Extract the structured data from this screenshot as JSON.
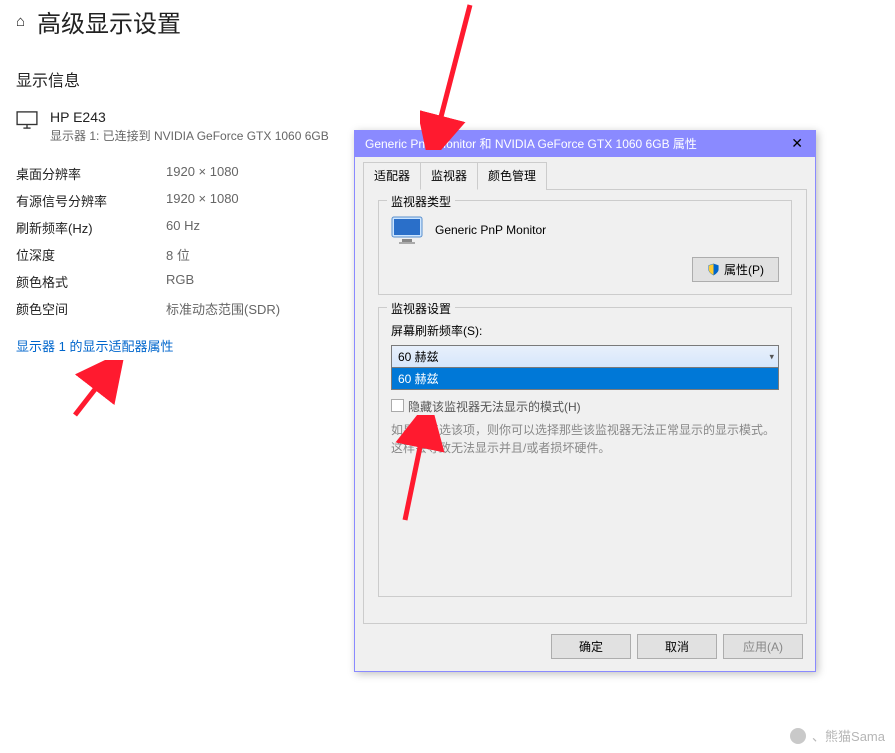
{
  "header": {
    "title": "高级显示设置"
  },
  "section_title": "显示信息",
  "monitor": {
    "name": "HP E243",
    "desc": "显示器 1: 已连接到 NVIDIA GeForce GTX 1060 6GB"
  },
  "props": [
    {
      "label": "桌面分辨率",
      "value": "1920 × 1080"
    },
    {
      "label": "有源信号分辨率",
      "value": "1920 × 1080"
    },
    {
      "label": "刷新频率(Hz)",
      "value": "60 Hz"
    },
    {
      "label": "位深度",
      "value": "8 位"
    },
    {
      "label": "颜色格式",
      "value": "RGB"
    },
    {
      "label": "颜色空间",
      "value": "标准动态范围(SDR)"
    }
  ],
  "link": "显示器 1 的显示适配器属性",
  "dialog": {
    "title": "Generic PnP Monitor 和 NVIDIA GeForce GTX 1060 6GB 属性",
    "tabs": {
      "adapter": "适配器",
      "monitor": "监视器",
      "color": "颜色管理"
    },
    "group1_title": "监视器类型",
    "monitor_type": "Generic PnP Monitor",
    "properties_btn": "属性(P)",
    "group2_title": "监视器设置",
    "refresh_label": "屏幕刷新频率(S):",
    "refresh_value": "60 赫兹",
    "refresh_option": "60 赫兹",
    "checkbox_label": "隐藏该监视器无法显示的模式(H)",
    "hint": "如果不复选该项，则你可以选择那些该监视器无法正常显示的显示模式。这样会导致无法显示并且/或者损坏硬件。",
    "ok_btn": "确定",
    "cancel_btn": "取消",
    "apply_btn": "应用(A)"
  },
  "watermark": "、熊猫Sama"
}
